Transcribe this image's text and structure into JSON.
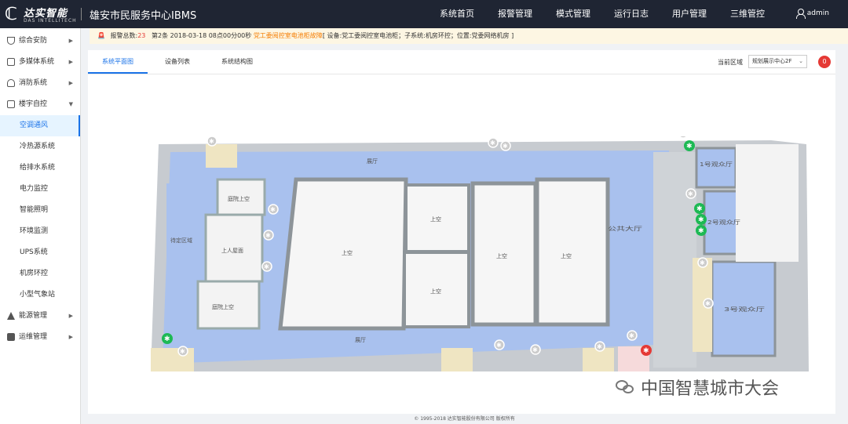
{
  "header": {
    "logo_cn": "达实智能",
    "logo_en": "DAS INTELLITECH",
    "app_title": "雄安市民服务中心IBMS",
    "nav": [
      "系统首页",
      "报警管理",
      "模式管理",
      "运行日志",
      "用户管理",
      "三维管控"
    ],
    "user": "admin"
  },
  "sidebar": {
    "items": [
      {
        "label": "综合安防",
        "icon": "shield-icon"
      },
      {
        "label": "多媒体系统",
        "icon": "media-icon"
      },
      {
        "label": "消防系统",
        "icon": "fire-icon"
      },
      {
        "label": "楼宇自控",
        "icon": "building-icon",
        "expanded": true
      }
    ],
    "subitems": [
      "空调通风",
      "冷热源系统",
      "给排水系统",
      "电力监控",
      "智能照明",
      "环境监测",
      "UPS系统",
      "机房环控",
      "小型气象站"
    ],
    "active_sub": "空调通风",
    "bottom_items": [
      {
        "label": "能源管理",
        "icon": "energy-icon"
      },
      {
        "label": "运维管理",
        "icon": "maintenance-icon"
      }
    ]
  },
  "alarm": {
    "prefix": "报警总数:",
    "count": "23",
    "detail": "第2条 2018-03-18 08点00分00秒",
    "location": "党工委阅控室电池柜故障",
    "info": "[ 设备:党工委阅控室电池柜；子系统:机房环控；位置:党委网络机房 ]"
  },
  "tabs": [
    "系统平面图",
    "设备列表",
    "系统结构图"
  ],
  "active_tab": "系统平面图",
  "region": {
    "label": "当前区域",
    "value": "规划展示中心2F"
  },
  "alarm_badge": "0",
  "floorplan": {
    "rooms": {
      "hall_top": "展厅",
      "hall_bottom": "展厅",
      "waiting": "待定区域",
      "courtyard_top": "庭院上空",
      "roof": "上人屋面",
      "courtyard_bottom": "庭院上空",
      "void_big": "上空",
      "void_1": "上空",
      "void_2": "上空",
      "void_3": "上空",
      "void_4": "上空",
      "lobby": "公共大厅",
      "hall1": "1号观众厅",
      "hall2": "2号观众厅",
      "hall3": "3号观众厅"
    }
  },
  "footer": "© 1995-2018 达实智能股份有限公司 版权所有",
  "watermark": "中国智慧城市大会"
}
